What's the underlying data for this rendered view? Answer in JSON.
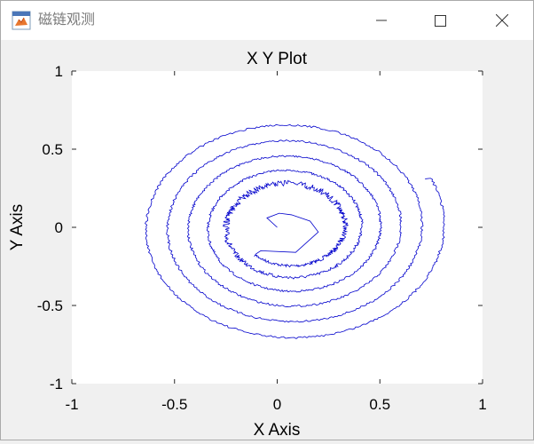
{
  "window": {
    "title": "磁链观测",
    "icon": "matlab-figure-icon"
  },
  "controls": {
    "minimize": "minimize-icon",
    "maximize": "maximize-icon",
    "close": "close-icon"
  },
  "chart_data": {
    "type": "line",
    "title": "X Y Plot",
    "xlabel": "X Axis",
    "ylabel": "Y Axis",
    "xlim": [
      -1,
      1
    ],
    "ylim": [
      -1,
      1
    ],
    "xticks": [
      -1,
      -0.5,
      0,
      0.5,
      1
    ],
    "yticks": [
      -1,
      -0.5,
      0,
      0.5,
      1
    ],
    "xtick_labels": [
      "-1",
      "-0.5",
      "0",
      "0.5",
      "1"
    ],
    "ytick_labels": [
      "-1",
      "-0.5",
      "0",
      "0.5",
      "1"
    ],
    "grid": false,
    "series": [
      {
        "color": "#0000cc",
        "curve": "outward spiral",
        "center": [
          0.06,
          0.0
        ],
        "start": [
          0.0,
          0.0
        ],
        "end": [
          0.72,
          0.31
        ],
        "max_radius_x": 0.76,
        "max_radius_y": 0.74
      }
    ]
  }
}
